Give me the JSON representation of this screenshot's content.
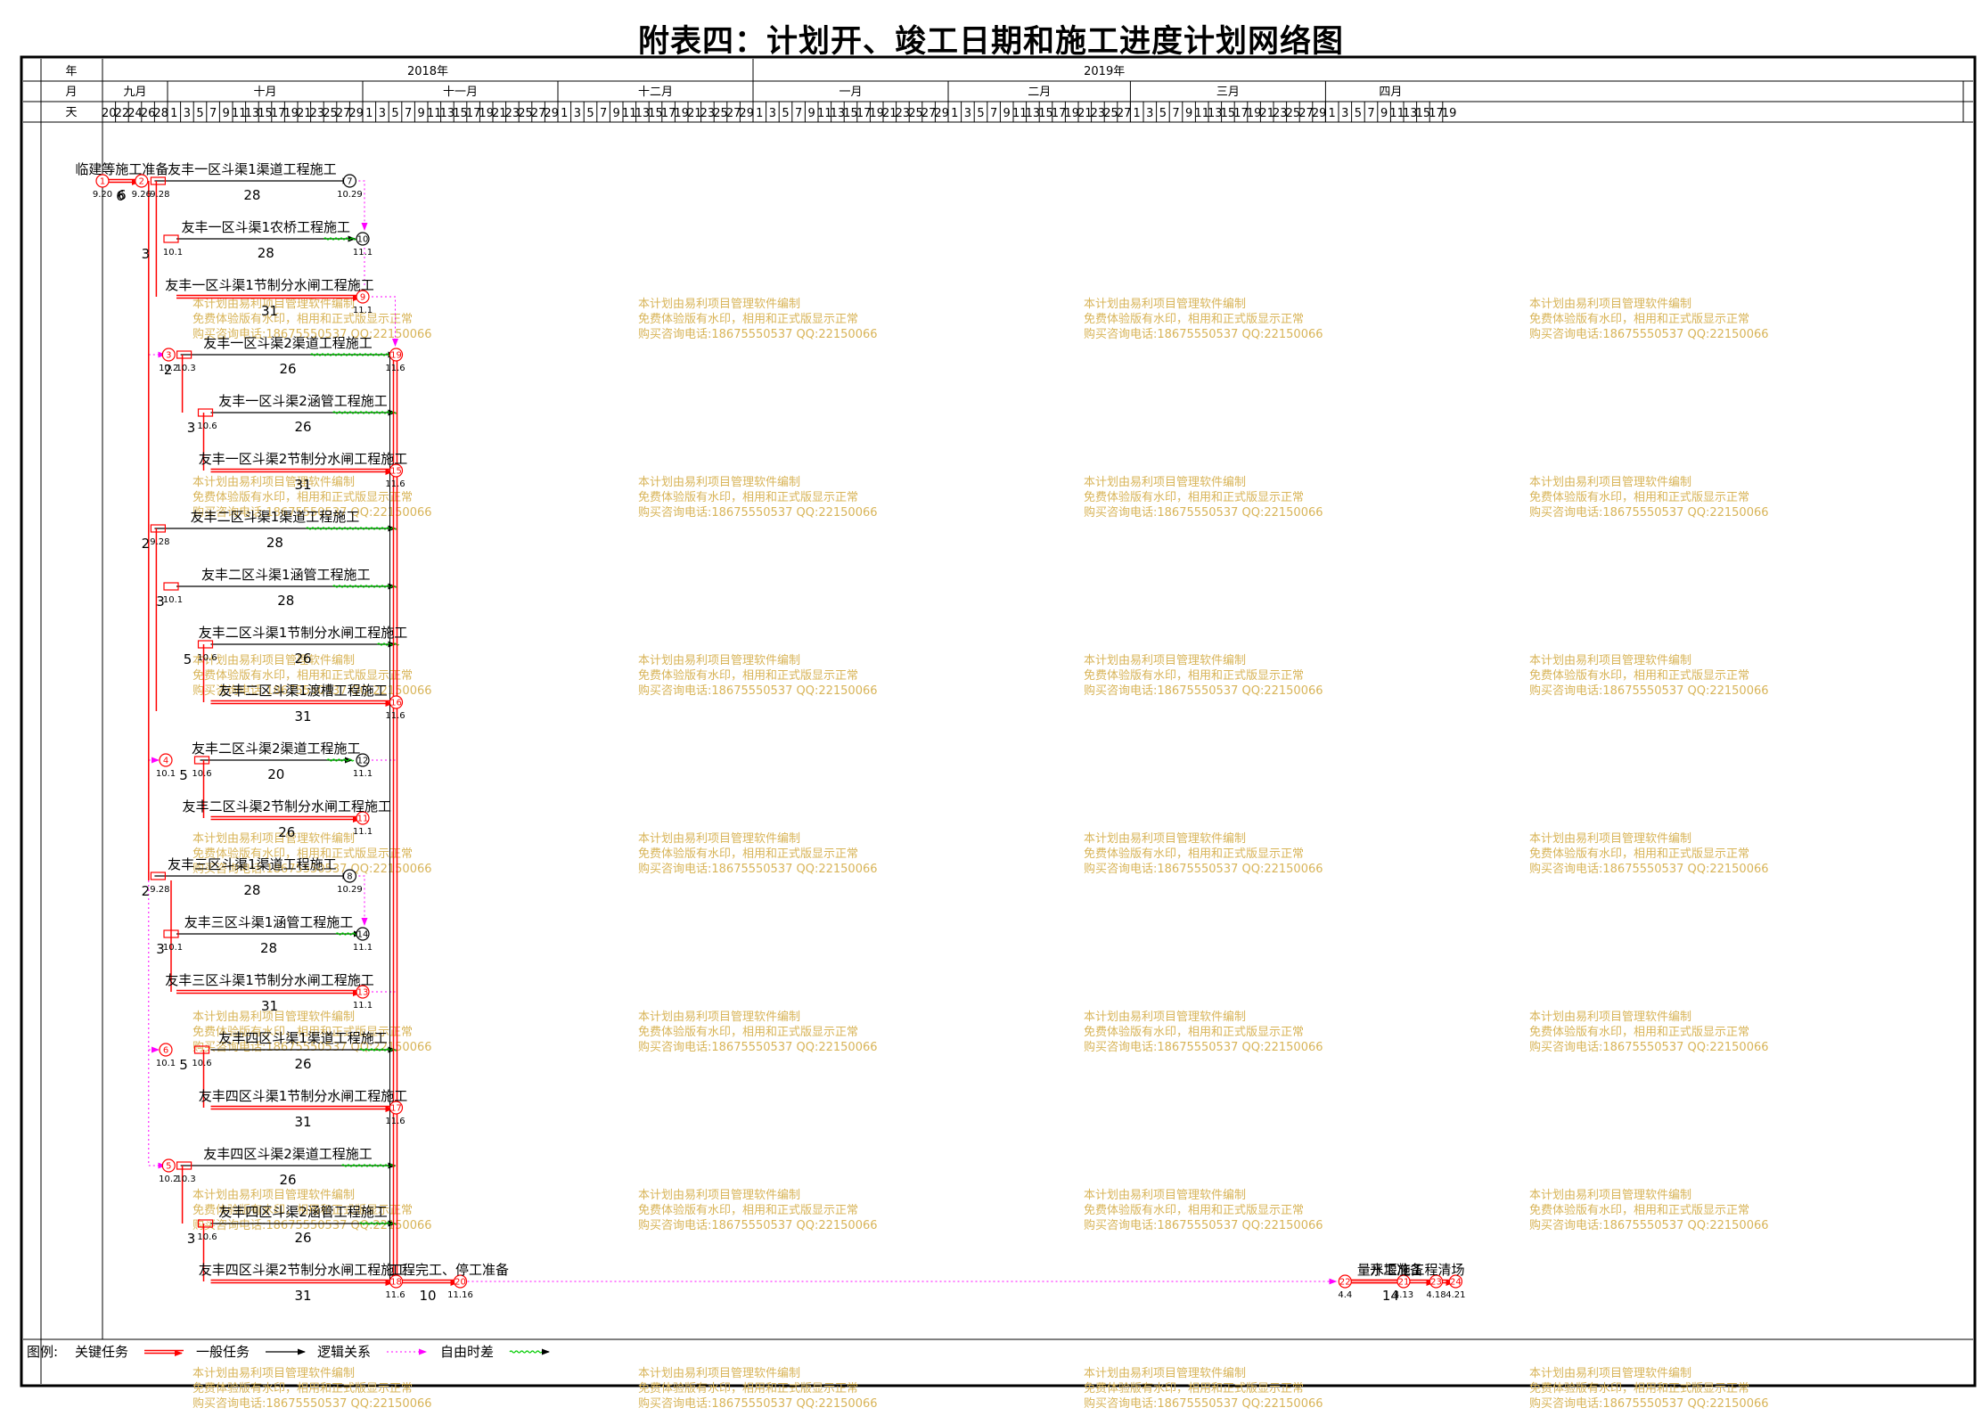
{
  "title": "附表四：计划开、竣工日期和施工进度计划网络图",
  "header": {
    "row_labels": [
      "年",
      "月",
      "天"
    ],
    "years": [
      "2018年",
      "2019年"
    ],
    "months": [
      "九月",
      "十月",
      "十一月",
      "十二月",
      "一月",
      "二月",
      "三月",
      "四月"
    ],
    "days": [
      [
        "20",
        "22",
        "24",
        "26",
        "28"
      ],
      [
        "1",
        "3",
        "5",
        "7",
        "9",
        "11",
        "13",
        "15",
        "17",
        "19",
        "21",
        "23",
        "25",
        "27",
        "29"
      ],
      [
        "1",
        "3",
        "5",
        "7",
        "9",
        "11",
        "13",
        "15",
        "17",
        "19",
        "21",
        "23",
        "25",
        "27",
        "29"
      ],
      [
        "1",
        "3",
        "5",
        "7",
        "9",
        "11",
        "13",
        "15",
        "17",
        "19",
        "21",
        "23",
        "25",
        "27",
        "29"
      ],
      [
        "1",
        "3",
        "5",
        "7",
        "9",
        "11",
        "13",
        "15",
        "17",
        "19",
        "21",
        "23",
        "25",
        "27",
        "29"
      ],
      [
        "1",
        "3",
        "5",
        "7",
        "9",
        "11",
        "13",
        "15",
        "17",
        "19",
        "21",
        "23",
        "25",
        "27"
      ],
      [
        "1",
        "3",
        "5",
        "7",
        "9",
        "11",
        "13",
        "15",
        "17",
        "19",
        "21",
        "23",
        "25",
        "27",
        "29"
      ],
      [
        "1",
        "3",
        "5",
        "7",
        "9",
        "11",
        "13",
        "15",
        "17",
        "19"
      ]
    ]
  },
  "tasks": [
    {
      "name": "临建等施工准备",
      "duration": "6",
      "critical": true
    },
    {
      "name": "友丰一区斗渠1渠道工程施工",
      "duration": "28",
      "critical": false
    },
    {
      "name": "友丰一区斗渠1农桥工程施工",
      "duration": "28",
      "critical": false
    },
    {
      "name": "友丰一区斗渠1节制分水闸工程施工",
      "duration": "31",
      "critical": true
    },
    {
      "name": "友丰一区斗渠2渠道工程施工",
      "duration": "26",
      "critical": false
    },
    {
      "name": "友丰一区斗渠2涵管工程施工",
      "duration": "26",
      "critical": false
    },
    {
      "name": "友丰一区斗渠2节制分水闸工程施工",
      "duration": "31",
      "critical": true
    },
    {
      "name": "友丰二区斗渠1渠道工程施工",
      "duration": "28",
      "critical": false
    },
    {
      "name": "友丰二区斗渠1涵管工程施工",
      "duration": "28",
      "critical": false
    },
    {
      "name": "友丰二区斗渠1节制分水闸工程施工",
      "duration": "26",
      "critical": false
    },
    {
      "name": "友丰二区斗渠1渡槽工程施工",
      "duration": "31",
      "critical": true
    },
    {
      "name": "友丰二区斗渠2渠道工程施工",
      "duration": "20",
      "critical": false
    },
    {
      "name": "友丰二区斗渠2节制分水闸工程施工",
      "duration": "26",
      "critical": true
    },
    {
      "name": "友丰三区斗渠1渠道工程施工",
      "duration": "28",
      "critical": false
    },
    {
      "name": "友丰三区斗渠1涵管工程施工",
      "duration": "28",
      "critical": false
    },
    {
      "name": "友丰三区斗渠1节制分水闸工程施工",
      "duration": "31",
      "critical": true
    },
    {
      "name": "友丰四区斗渠1渠道工程施工",
      "duration": "26",
      "critical": false
    },
    {
      "name": "友丰四区斗渠1节制分水闸工程施工",
      "duration": "31",
      "critical": true
    },
    {
      "name": "友丰四区斗渠2渠道工程施工",
      "duration": "26",
      "critical": false
    },
    {
      "name": "友丰四区斗渠2涵管工程施工",
      "duration": "26",
      "critical": false
    },
    {
      "name": "友丰四区斗渠2节制分水闸工程施工",
      "duration": "31",
      "critical": true
    },
    {
      "name": "工程完工、停工准备",
      "duration": "10",
      "critical": true
    },
    {
      "name": "开工准备",
      "duration": "",
      "critical": true
    },
    {
      "name": "量水堰施工",
      "duration": "14",
      "critical": true
    },
    {
      "name": "工程清场",
      "duration": "",
      "critical": true
    }
  ],
  "nodes": [
    "1",
    "2",
    "3",
    "4",
    "5",
    "6",
    "7",
    "8",
    "9",
    "10",
    "11",
    "12",
    "13",
    "14",
    "15",
    "16",
    "17",
    "18",
    "19",
    "20",
    "21",
    "22",
    "23",
    "24"
  ],
  "node_dates": [
    "9.20",
    "9.26",
    "9.28",
    "10.1",
    "10.2",
    "10.3",
    "10.6",
    "10.29",
    "11.1",
    "11.6",
    "11.16",
    "4.13",
    "4.4",
    "4.18",
    "4.21"
  ],
  "float_labels": [
    "2",
    "3",
    "5"
  ],
  "watermark": [
    "本计划由易利项目管理软件编制",
    "免费体验版有水印，相用和正式版显示正常",
    "购买咨询电话:18675550537 QQ:22150066"
  ],
  "legend": {
    "label": "图例:",
    "items": [
      "关键任务",
      "一般任务",
      "逻辑关系",
      "自由时差"
    ]
  },
  "colors": {
    "critical": "#ff0000",
    "normal": "#000000",
    "logic": "#ff00ff",
    "float": "#00cc00",
    "watermark": "#d8b458"
  }
}
